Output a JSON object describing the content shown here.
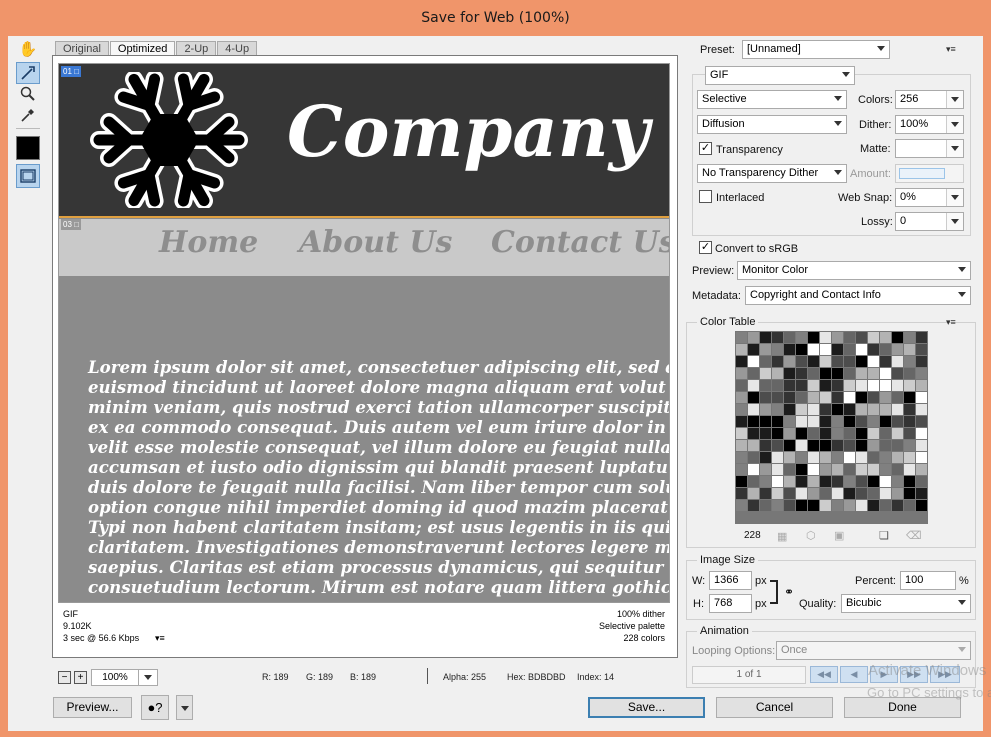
{
  "window": {
    "title": "Save for Web (100%)"
  },
  "tabs": [
    "Original",
    "Optimized",
    "2-Up",
    "4-Up"
  ],
  "preview_image": {
    "company_name": "Company N",
    "nav": [
      "Home",
      "About Us",
      "Contact Us"
    ],
    "slice_labels": [
      "01",
      "03"
    ],
    "body_lines": [
      "Lorem ipsum dolor sit amet, consectetuer adipiscing elit, sed d",
      "euismod tincidunt ut laoreet dolore magna aliquam erat volut",
      "minim veniam, quis nostrud exerci tation ullamcorper suscipit",
      "ex ea commodo consequat. Duis autem vel eum iriure dolor in",
      "velit esse molestie consequat, vel illum dolore eu feugiat nulla",
      "accumsan et iusto odio dignissim qui blandit praesent luptatu",
      "duis dolore te feugait nulla facilisi. Nam liber tempor cum solu",
      "option congue nihil imperdiet doming id quod mazim placerat",
      "Typi non habent claritatem insitam; est usus legentis in iis qui",
      "claritatem. Investigationes demonstraverunt lectores legere m",
      "saepius. Claritas est etiam processus dynamicus, qui sequitur m",
      "consuetudium lectorum. Mirum est notare quam littera gothic"
    ]
  },
  "info": {
    "format": "GIF",
    "size": "9.102K",
    "time": "3 sec @ 56.6 Kbps",
    "dither": "100% dither",
    "palette": "Selective palette",
    "colors": "228 colors"
  },
  "statusbar": {
    "zoom": "100%",
    "r": "R: 189",
    "g": "G: 189",
    "b": "B: 189",
    "alpha": "Alpha: 255",
    "hex": "Hex: BDBDBD",
    "index": "Index: 14"
  },
  "buttons": {
    "preview": "Preview...",
    "save": "Save...",
    "cancel": "Cancel",
    "done": "Done"
  },
  "settings": {
    "preset_label": "Preset:",
    "preset_value": "[Unnamed]",
    "format": "GIF",
    "reduction": "Selective",
    "colors_label": "Colors:",
    "colors_value": "256",
    "dither_algo": "Diffusion",
    "dither_label": "Dither:",
    "dither_value": "100%",
    "transparency_label": "Transparency",
    "transparency_checked": true,
    "matte_label": "Matte:",
    "matte_value": "",
    "transparency_dither": "No Transparency Dither",
    "amount_label": "Amount:",
    "interlaced_label": "Interlaced",
    "interlaced_checked": false,
    "websnap_label": "Web Snap:",
    "websnap_value": "0%",
    "lossy_label": "Lossy:",
    "lossy_value": "0",
    "srgb_label": "Convert to sRGB",
    "srgb_checked": true,
    "preview_label": "Preview:",
    "preview_value": "Monitor Color",
    "metadata_label": "Metadata:",
    "metadata_value": "Copyright and Contact Info"
  },
  "color_table": {
    "title": "Color Table",
    "count": "228"
  },
  "image_size": {
    "title": "Image Size",
    "w_label": "W:",
    "w_value": "1366",
    "h_label": "H:",
    "h_value": "768",
    "unit": "px",
    "percent_label": "Percent:",
    "percent_value": "100",
    "percent_unit": "%",
    "quality_label": "Quality:",
    "quality_value": "Bicubic"
  },
  "animation": {
    "title": "Animation",
    "looping_label": "Looping Options:",
    "looping_value": "Once",
    "frame": "1 of 1"
  },
  "watermark": [
    "Activate Windows",
    "Go to PC settings to activate Windows."
  ]
}
